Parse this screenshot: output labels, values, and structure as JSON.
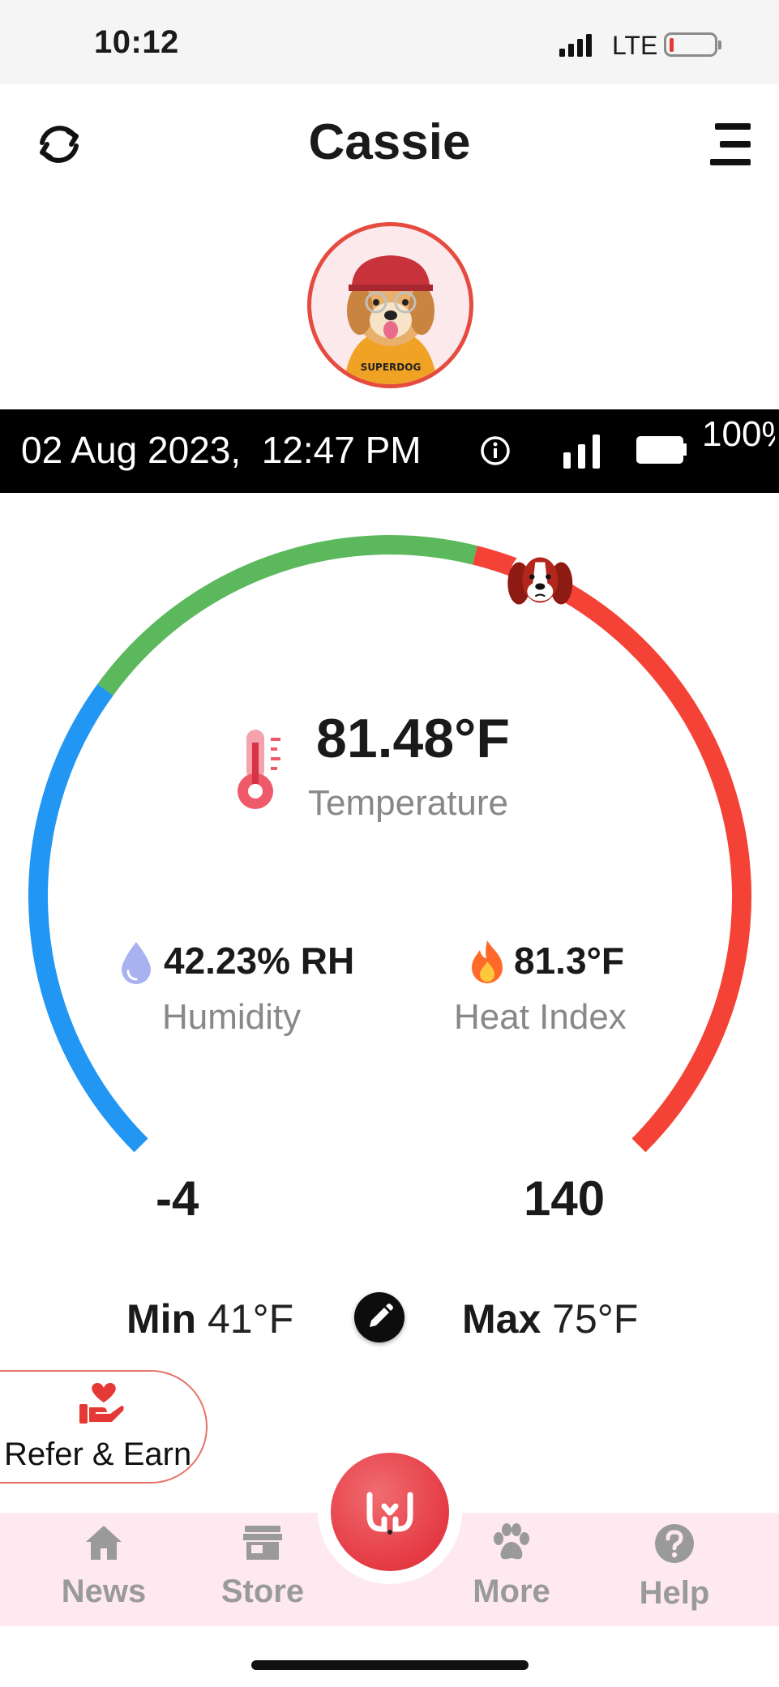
{
  "status_bar": {
    "time": "10:12",
    "network": "LTE"
  },
  "header": {
    "title": "Cassie"
  },
  "device_info": {
    "datetime": "02 Aug 2023,  12:47 PM",
    "battery": "100%"
  },
  "gauge": {
    "range_min": "-4",
    "range_max": "140",
    "current_value": 81.48,
    "zone_colors": {
      "cold": "#2196f3",
      "ok": "#5cb85c",
      "hot": "#f44336"
    }
  },
  "temperature": {
    "value": "81.48°F",
    "label": "Temperature"
  },
  "humidity": {
    "value": "42.23% RH",
    "label": "Humidity"
  },
  "heat_index": {
    "value": "81.3°F",
    "label": "Heat Index"
  },
  "limits": {
    "min_label": "Min",
    "min_value": "41°F",
    "max_label": "Max",
    "max_value": "75°F"
  },
  "refer": {
    "label": "Refer & Earn"
  },
  "bottom_nav": {
    "items": [
      {
        "label": "News",
        "icon": "home-icon"
      },
      {
        "label": "Store",
        "icon": "store-icon"
      },
      {
        "label": "More",
        "icon": "paw-icon"
      },
      {
        "label": "Help",
        "icon": "help-icon"
      }
    ],
    "center_icon": "woof-logo-icon"
  },
  "avatar": {
    "text": "SUPERDOG"
  }
}
